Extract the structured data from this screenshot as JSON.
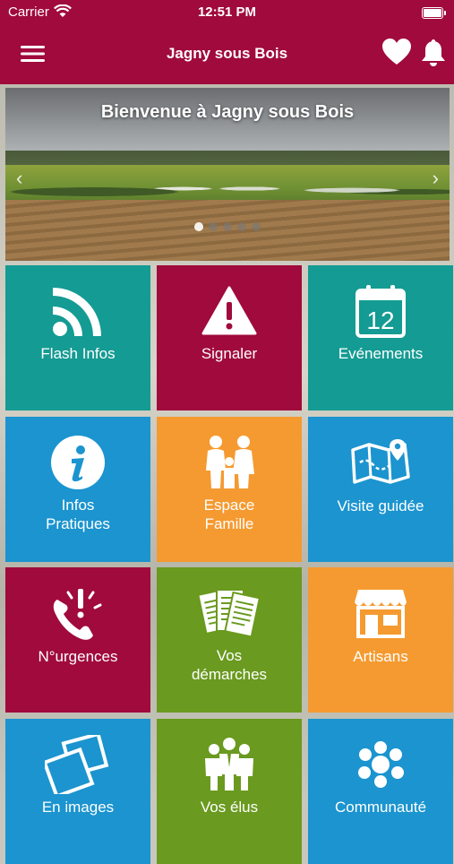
{
  "status_bar": {
    "carrier": "Carrier",
    "time": "12:51 PM"
  },
  "nav": {
    "title": "Jagny sous Bois",
    "menu_icon": "hamburger-menu-icon",
    "favorites_icon": "heart-icon",
    "notifications_icon": "bell-icon"
  },
  "banner": {
    "title": "Bienvenue à Jagny sous Bois",
    "slide_count": 5,
    "active_slide": 1,
    "prev_icon": "chevron-left-icon",
    "next_icon": "chevron-right-icon"
  },
  "colors": {
    "brand": "#a00a3c",
    "teal": "#149b93",
    "blue": "#1b94cf",
    "orange": "#f59a30",
    "green": "#6a9a1f"
  },
  "tiles": [
    {
      "label": "Flash Infos",
      "icon": "rss-icon",
      "color": "#149b93"
    },
    {
      "label": "Signaler",
      "icon": "warning-icon",
      "color": "#a00a3c"
    },
    {
      "label": "Evénements",
      "icon": "calendar-icon",
      "icon_text": "12",
      "color": "#149b93"
    },
    {
      "label": "Infos\nPratiques",
      "icon": "info-icon",
      "color": "#1b94cf"
    },
    {
      "label": "Espace\nFamille",
      "icon": "family-icon",
      "color": "#f59a30"
    },
    {
      "label": "Visite guidée",
      "icon": "map-icon",
      "color": "#1b94cf"
    },
    {
      "label": "N°urgences",
      "icon": "emergency-phone-icon",
      "color": "#a00a3c"
    },
    {
      "label": "Vos\ndémarches",
      "icon": "documents-icon",
      "color": "#6a9a1f"
    },
    {
      "label": "Artisans",
      "icon": "shop-icon",
      "color": "#f59a30"
    },
    {
      "label": "En images",
      "icon": "photos-icon",
      "color": "#1b94cf"
    },
    {
      "label": "Vos élus",
      "icon": "people-icon",
      "color": "#6a9a1f"
    },
    {
      "label": "Communauté",
      "icon": "community-icon",
      "color": "#1b94cf"
    }
  ]
}
